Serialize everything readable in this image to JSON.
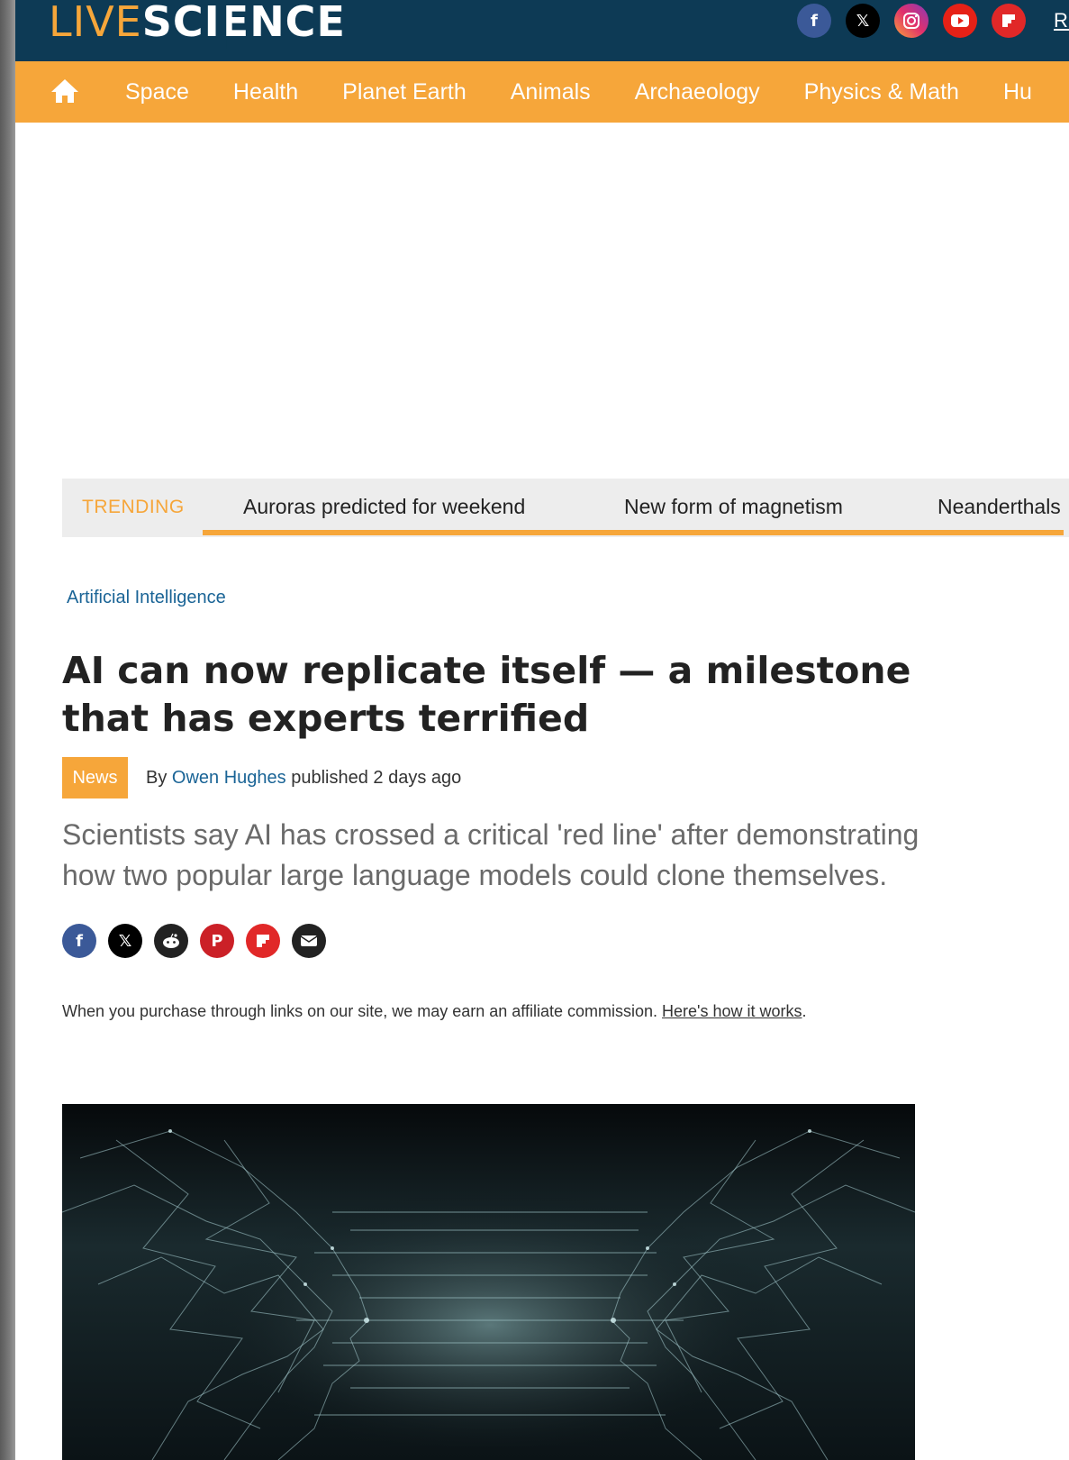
{
  "header": {
    "logo": {
      "part1": "LIVE",
      "part2": "SCIENCE"
    },
    "social_icons": [
      "facebook-icon",
      "x-icon",
      "instagram-icon",
      "youtube-icon",
      "flipboard-icon"
    ],
    "rss_label": "RSS"
  },
  "nav": {
    "home_icon": "home-icon",
    "items": [
      "Space",
      "Health",
      "Planet Earth",
      "Animals",
      "Archaeology",
      "Physics & Math",
      "Hu"
    ]
  },
  "trending": {
    "label": "TRENDING",
    "links": [
      "Auroras predicted for weekend",
      "New form of magnetism",
      "Neanderthals"
    ]
  },
  "article": {
    "category": "Artificial Intelligence",
    "headline": "AI can now replicate itself — a milestone that has experts terrified",
    "badge": "News",
    "by": "By",
    "author": "Owen Hughes",
    "published": "published 2 days ago",
    "standfirst": "Scientists say AI has crossed a critical 'red line' after demonstrating how two popular large language models could clone themselves.",
    "share_icons": [
      "facebook-icon",
      "x-icon",
      "reddit-icon",
      "pinterest-icon",
      "flipboard-icon",
      "email-icon"
    ],
    "affiliate_text": "When you purchase through links on our site, we may earn an affiliate commission.",
    "affiliate_link": "Here's how it works",
    "affiliate_end": "."
  },
  "colors": {
    "topbar": "#0d3a55",
    "accent": "#f6a63a",
    "link": "#1a6496"
  }
}
